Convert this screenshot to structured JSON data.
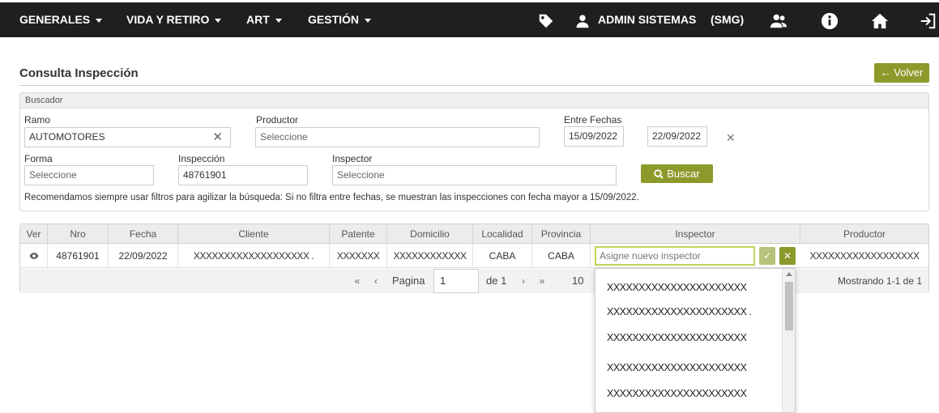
{
  "nav": {
    "menus": [
      "GENERALES",
      "VIDA Y RETIRO",
      "ART",
      "GESTIÓN"
    ],
    "user_name": "ADMIN SISTEMAS",
    "user_org": "(SMG)",
    "icons": [
      "tag-icon",
      "user-icon",
      "users-icon",
      "info-icon",
      "home-icon",
      "logout-icon"
    ]
  },
  "page": {
    "title": "Consulta Inspección",
    "back_label": "← Volver"
  },
  "search": {
    "panel_title": "Buscador",
    "ramo_label": "Ramo",
    "ramo_value": "AUTOMOTORES",
    "productor_label": "Productor",
    "productor_placeholder": "Seleccione",
    "fechas_label": "Entre Fechas",
    "fecha_desde": "15/09/2022",
    "fecha_hasta": "22/09/2022",
    "forma_label": "Forma",
    "forma_placeholder": "Seleccione",
    "inspeccion_label": "Inspección",
    "inspeccion_value": "48761901",
    "inspector_label": "Inspector",
    "inspector_placeholder": "Seleccione",
    "buscar_label": "Buscar",
    "note": "Recomendamos siempre usar filtros para agilizar la búsqueda: Si no filtra entre fechas, se muestran las inspecciones con fecha mayor a 15/09/2022."
  },
  "grid": {
    "headers": [
      "Ver",
      "Nro",
      "Fecha",
      "Cliente",
      "Patente",
      "Domicilio",
      "Localidad",
      "Provincia",
      "Inspector",
      "Productor"
    ],
    "row": {
      "nro": "48761901",
      "fecha": "22/09/2022",
      "cliente": "XXXXXXXXXXXXXXXXXXX .",
      "patente": "XXXXXXX",
      "domicilio": "XXXXXXXXXXXX",
      "localidad": "CABA",
      "provincia": "CABA",
      "inspector_placeholder": "Asigne nuevo inspector",
      "productor": "XXXXXXXXXXXXXXXXXX"
    },
    "pager": {
      "first": "«",
      "prev": "‹",
      "pagina_label": "Pagina",
      "page": "1",
      "de_label": "de 1",
      "next": "›",
      "last": "»",
      "page_size": "10",
      "showing": "Mostrando 1-1 de 1"
    }
  },
  "dropdown": {
    "options": [
      "XXXXXXXXXXXXXXXXXXXXXX",
      "XXXXXXXXXXXXXXXXXXXXXX .",
      "XXXXXXXXXXXXXXXXXXXXXX",
      "XXXXXXXXXXXXXXXXXXXXXX",
      "XXXXXXXXXXXXXXXXXXXXXX"
    ]
  }
}
